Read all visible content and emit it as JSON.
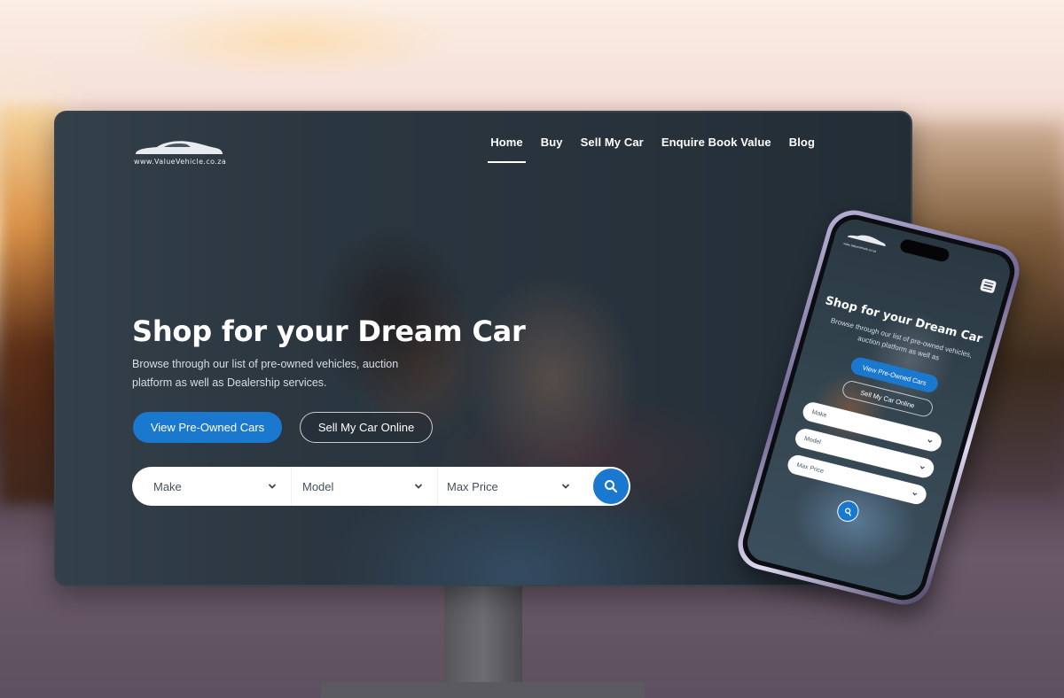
{
  "site": {
    "logo_text": "www.ValueVehicle.co.za",
    "brand_color": "#1a78cf"
  },
  "nav": {
    "items": [
      {
        "label": "Home",
        "active": true
      },
      {
        "label": "Buy",
        "active": false
      },
      {
        "label": "Sell My Car",
        "active": false
      },
      {
        "label": "Enquire Book Value",
        "active": false
      },
      {
        "label": "Blog",
        "active": false
      }
    ]
  },
  "hero": {
    "title": "Shop for your Dream Car",
    "subtitle": "Browse through our list of pre-owned vehicles, auction platform as well as Dealership services.",
    "primary_button": "View Pre-Owned Cars",
    "secondary_button": "Sell My Car Online"
  },
  "search": {
    "make_placeholder": "Make",
    "model_placeholder": "Model",
    "price_placeholder": "Max Price",
    "search_icon": "search-icon"
  },
  "mobile": {
    "logo_text": "www.ValueVehicle.co.za",
    "menu_icon": "hamburger-menu-icon",
    "title": "Shop for your Dream Car",
    "subtitle": "Browse through our list of pre-owned vehicles, auction platform as well as",
    "primary_button": "View Pre-Owned Cars",
    "secondary_button": "Sell My Car Online",
    "make_placeholder": "Make",
    "model_placeholder": "Model",
    "price_placeholder": "Max Price"
  }
}
